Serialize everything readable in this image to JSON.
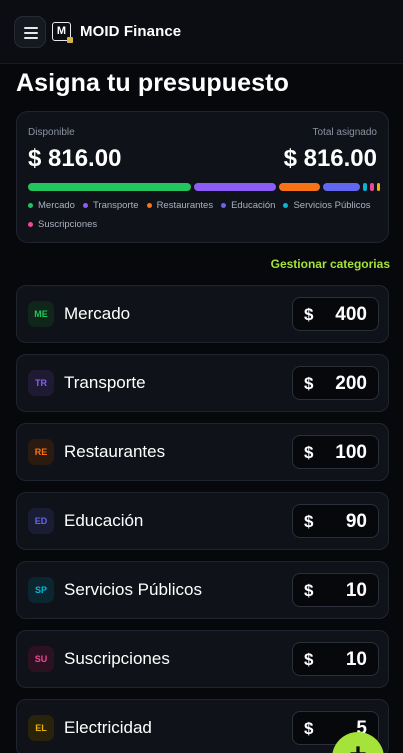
{
  "header": {
    "app_title": "MOID Finance",
    "logo_letter": "M",
    "menu_icon": "hamburger-menu-icon"
  },
  "page": {
    "title": "Asigna tu presupuesto"
  },
  "summary": {
    "available_label": "Disponible",
    "available_value": "$ 816.00",
    "assigned_label": "Total asignado",
    "assigned_value": "$ 816.00"
  },
  "manage_link": "Gestionar categorias",
  "categories": [
    {
      "abbr": "ME",
      "name": "Mercado",
      "currency": "$",
      "amount": "400",
      "color": "#22c55e",
      "badge_bg": "#10261a",
      "legend": "Mercado"
    },
    {
      "abbr": "TR",
      "name": "Transporte",
      "currency": "$",
      "amount": "200",
      "color": "#8b5cf6",
      "badge_bg": "#1e1a33",
      "legend": "Transporte"
    },
    {
      "abbr": "RE",
      "name": "Restaurantes",
      "currency": "$",
      "amount": "100",
      "color": "#f97316",
      "badge_bg": "#2a1a10",
      "legend": "Restaurantes"
    },
    {
      "abbr": "ED",
      "name": "Educación",
      "currency": "$",
      "amount": "90",
      "color": "#6366f1",
      "badge_bg": "#1a1c33",
      "legend": "Educación"
    },
    {
      "abbr": "SP",
      "name": "Servicios Públicos",
      "currency": "$",
      "amount": "10",
      "color": "#06b6d4",
      "badge_bg": "#0c2630",
      "legend": "Servicios Públicos"
    },
    {
      "abbr": "SU",
      "name": "Suscripciones",
      "currency": "$",
      "amount": "10",
      "color": "#ec4899",
      "badge_bg": "#2c1220",
      "legend": "Suscripciones"
    },
    {
      "abbr": "EL",
      "name": "Electricidad",
      "currency": "$",
      "amount": "5",
      "color": "#eab308",
      "badge_bg": "#2a230c",
      "legend": ""
    }
  ],
  "fab": {
    "label": "+",
    "icon": "plus-icon"
  }
}
